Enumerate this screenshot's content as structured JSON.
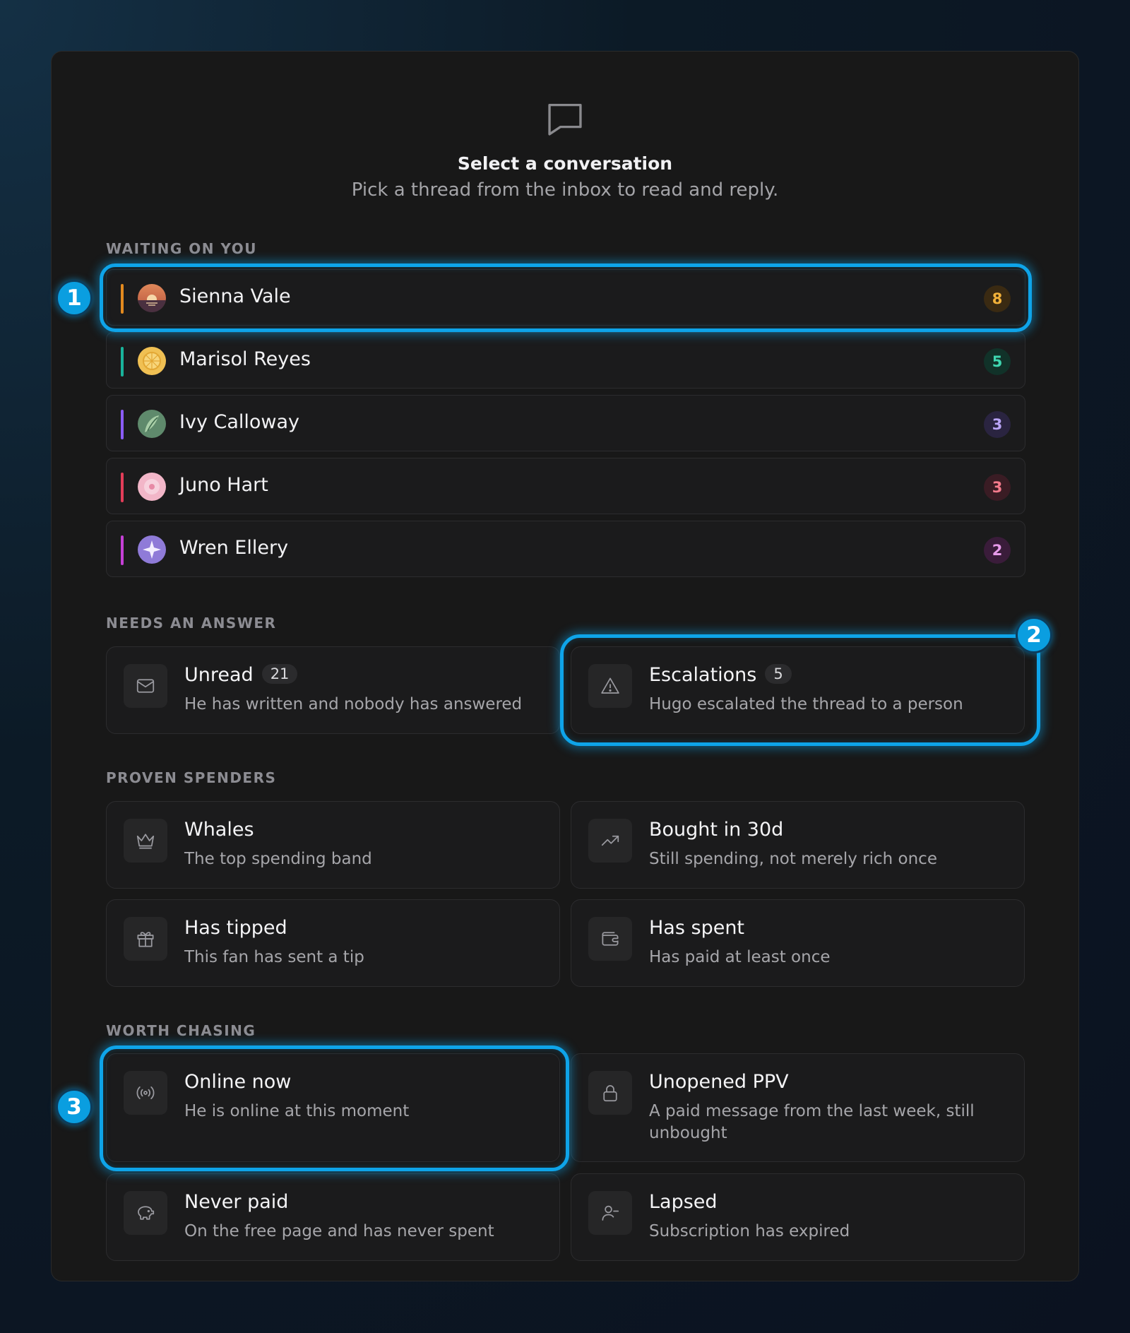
{
  "empty_state": {
    "icon": "message-square-icon",
    "title": "Select a conversation",
    "subtitle": "Pick a thread from the inbox to read and reply."
  },
  "sections": {
    "waiting": "WAITING ON YOU",
    "needs_answer": "NEEDS AN ANSWER",
    "proven_spenders": "PROVEN SPENDERS",
    "worth_chasing": "WORTH CHASING"
  },
  "threads": [
    {
      "name": "Sienna Vale",
      "count": "8",
      "bar": "#e38a1f",
      "badge_bg": "#3a2a12",
      "badge_fg": "#f2b13a"
    },
    {
      "name": "Marisol Reyes",
      "count": "5",
      "bar": "#19b39b",
      "badge_bg": "#113229",
      "badge_fg": "#3fd6b0"
    },
    {
      "name": "Ivy Calloway",
      "count": "3",
      "bar": "#8b5cf6",
      "badge_bg": "#2a2440",
      "badge_fg": "#b9a4f5"
    },
    {
      "name": "Juno Hart",
      "count": "3",
      "bar": "#e23d59",
      "badge_bg": "#3a1c24",
      "badge_fg": "#f47a8c"
    },
    {
      "name": "Wren Ellery",
      "count": "2",
      "bar": "#c640d6",
      "badge_bg": "#3a1c3a",
      "badge_fg": "#e79ae9"
    }
  ],
  "needs_answer": [
    {
      "title": "Unread",
      "badge": "21",
      "sub": "He has written and nobody has answered",
      "icon": "mail-icon"
    },
    {
      "title": "Escalations",
      "badge": "5",
      "sub": "Hugo escalated the thread to a person",
      "icon": "warning-triangle-icon"
    }
  ],
  "proven_spenders": [
    {
      "title": "Whales",
      "sub": "The top spending band",
      "icon": "crown-icon"
    },
    {
      "title": "Bought in 30d",
      "sub": "Still spending, not merely rich once",
      "icon": "trending-up-icon"
    },
    {
      "title": "Has tipped",
      "sub": "This fan has sent a tip",
      "icon": "gift-icon"
    },
    {
      "title": "Has spent",
      "sub": "Has paid at least once",
      "icon": "wallet-icon"
    }
  ],
  "worth_chasing": [
    {
      "title": "Online now",
      "sub": "He is online at this moment",
      "icon": "radio-signal-icon"
    },
    {
      "title": "Unopened PPV",
      "sub": "A paid message from the last week, still unbought",
      "icon": "lock-icon"
    },
    {
      "title": "Never paid",
      "sub": "On the free page and has never spent",
      "icon": "piggy-bank-icon"
    },
    {
      "title": "Lapsed",
      "sub": "Subscription has expired",
      "icon": "user-minus-icon"
    }
  ],
  "markers": [
    "1",
    "2",
    "3"
  ],
  "accent": "#0ea4e9"
}
